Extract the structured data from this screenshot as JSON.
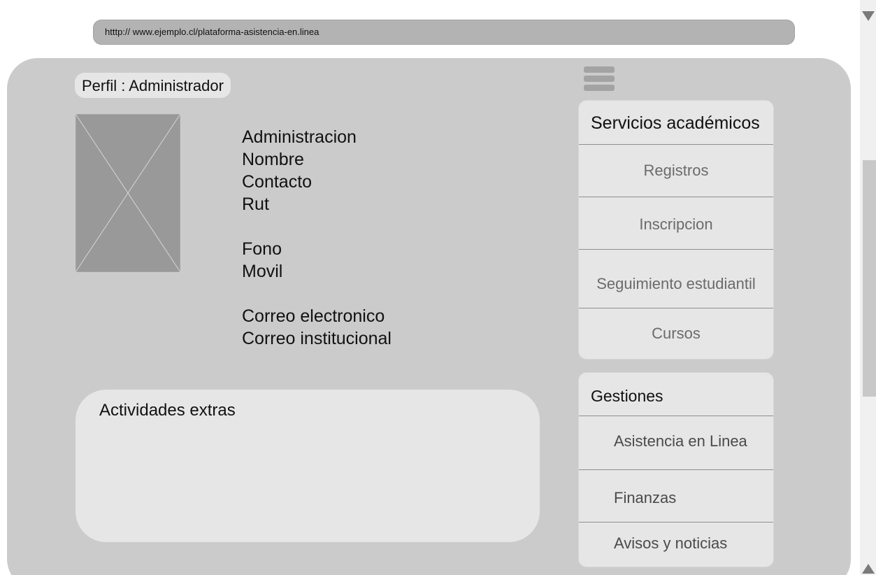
{
  "browser": {
    "url": "htttp:// www.ejemplo.cl/plataforma-asistencia-en.linea"
  },
  "profile": {
    "label": "Perfil : Administrador"
  },
  "info": {
    "role": "Administracion",
    "name": "Nombre",
    "contact": "Contacto",
    "rut": "Rut",
    "phone": "Fono",
    "mobile": "Movil",
    "email": "Correo electronico",
    "institutional_email": "Correo institucional"
  },
  "extras": {
    "title": "Actividades extras"
  },
  "menu_icon": "hamburger-menu-icon",
  "academic": {
    "title": "Servicios académicos",
    "items": [
      "Registros",
      "Inscripcion",
      "Seguimiento estudiantil",
      "Cursos"
    ]
  },
  "management": {
    "title": "Gestiones",
    "items": [
      "Asistencia en Linea",
      "Finanzas",
      "Avisos y noticias"
    ]
  }
}
